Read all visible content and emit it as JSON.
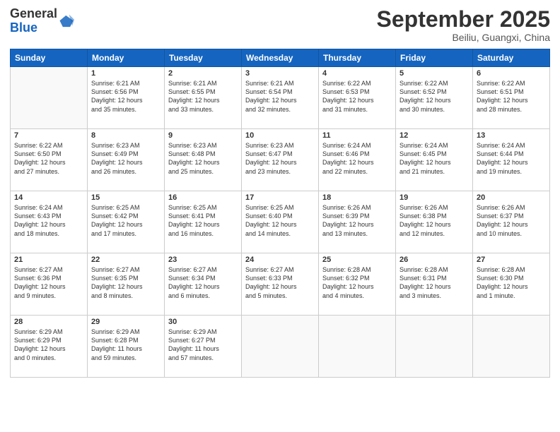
{
  "header": {
    "logo_general": "General",
    "logo_blue": "Blue",
    "month_title": "September 2025",
    "location": "Beiliu, Guangxi, China"
  },
  "days_of_week": [
    "Sunday",
    "Monday",
    "Tuesday",
    "Wednesday",
    "Thursday",
    "Friday",
    "Saturday"
  ],
  "weeks": [
    [
      {
        "num": "",
        "info": ""
      },
      {
        "num": "1",
        "info": "Sunrise: 6:21 AM\nSunset: 6:56 PM\nDaylight: 12 hours\nand 35 minutes."
      },
      {
        "num": "2",
        "info": "Sunrise: 6:21 AM\nSunset: 6:55 PM\nDaylight: 12 hours\nand 33 minutes."
      },
      {
        "num": "3",
        "info": "Sunrise: 6:21 AM\nSunset: 6:54 PM\nDaylight: 12 hours\nand 32 minutes."
      },
      {
        "num": "4",
        "info": "Sunrise: 6:22 AM\nSunset: 6:53 PM\nDaylight: 12 hours\nand 31 minutes."
      },
      {
        "num": "5",
        "info": "Sunrise: 6:22 AM\nSunset: 6:52 PM\nDaylight: 12 hours\nand 30 minutes."
      },
      {
        "num": "6",
        "info": "Sunrise: 6:22 AM\nSunset: 6:51 PM\nDaylight: 12 hours\nand 28 minutes."
      }
    ],
    [
      {
        "num": "7",
        "info": "Sunrise: 6:22 AM\nSunset: 6:50 PM\nDaylight: 12 hours\nand 27 minutes."
      },
      {
        "num": "8",
        "info": "Sunrise: 6:23 AM\nSunset: 6:49 PM\nDaylight: 12 hours\nand 26 minutes."
      },
      {
        "num": "9",
        "info": "Sunrise: 6:23 AM\nSunset: 6:48 PM\nDaylight: 12 hours\nand 25 minutes."
      },
      {
        "num": "10",
        "info": "Sunrise: 6:23 AM\nSunset: 6:47 PM\nDaylight: 12 hours\nand 23 minutes."
      },
      {
        "num": "11",
        "info": "Sunrise: 6:24 AM\nSunset: 6:46 PM\nDaylight: 12 hours\nand 22 minutes."
      },
      {
        "num": "12",
        "info": "Sunrise: 6:24 AM\nSunset: 6:45 PM\nDaylight: 12 hours\nand 21 minutes."
      },
      {
        "num": "13",
        "info": "Sunrise: 6:24 AM\nSunset: 6:44 PM\nDaylight: 12 hours\nand 19 minutes."
      }
    ],
    [
      {
        "num": "14",
        "info": "Sunrise: 6:24 AM\nSunset: 6:43 PM\nDaylight: 12 hours\nand 18 minutes."
      },
      {
        "num": "15",
        "info": "Sunrise: 6:25 AM\nSunset: 6:42 PM\nDaylight: 12 hours\nand 17 minutes."
      },
      {
        "num": "16",
        "info": "Sunrise: 6:25 AM\nSunset: 6:41 PM\nDaylight: 12 hours\nand 16 minutes."
      },
      {
        "num": "17",
        "info": "Sunrise: 6:25 AM\nSunset: 6:40 PM\nDaylight: 12 hours\nand 14 minutes."
      },
      {
        "num": "18",
        "info": "Sunrise: 6:26 AM\nSunset: 6:39 PM\nDaylight: 12 hours\nand 13 minutes."
      },
      {
        "num": "19",
        "info": "Sunrise: 6:26 AM\nSunset: 6:38 PM\nDaylight: 12 hours\nand 12 minutes."
      },
      {
        "num": "20",
        "info": "Sunrise: 6:26 AM\nSunset: 6:37 PM\nDaylight: 12 hours\nand 10 minutes."
      }
    ],
    [
      {
        "num": "21",
        "info": "Sunrise: 6:27 AM\nSunset: 6:36 PM\nDaylight: 12 hours\nand 9 minutes."
      },
      {
        "num": "22",
        "info": "Sunrise: 6:27 AM\nSunset: 6:35 PM\nDaylight: 12 hours\nand 8 minutes."
      },
      {
        "num": "23",
        "info": "Sunrise: 6:27 AM\nSunset: 6:34 PM\nDaylight: 12 hours\nand 6 minutes."
      },
      {
        "num": "24",
        "info": "Sunrise: 6:27 AM\nSunset: 6:33 PM\nDaylight: 12 hours\nand 5 minutes."
      },
      {
        "num": "25",
        "info": "Sunrise: 6:28 AM\nSunset: 6:32 PM\nDaylight: 12 hours\nand 4 minutes."
      },
      {
        "num": "26",
        "info": "Sunrise: 6:28 AM\nSunset: 6:31 PM\nDaylight: 12 hours\nand 3 minutes."
      },
      {
        "num": "27",
        "info": "Sunrise: 6:28 AM\nSunset: 6:30 PM\nDaylight: 12 hours\nand 1 minute."
      }
    ],
    [
      {
        "num": "28",
        "info": "Sunrise: 6:29 AM\nSunset: 6:29 PM\nDaylight: 12 hours\nand 0 minutes."
      },
      {
        "num": "29",
        "info": "Sunrise: 6:29 AM\nSunset: 6:28 PM\nDaylight: 11 hours\nand 59 minutes."
      },
      {
        "num": "30",
        "info": "Sunrise: 6:29 AM\nSunset: 6:27 PM\nDaylight: 11 hours\nand 57 minutes."
      },
      {
        "num": "",
        "info": ""
      },
      {
        "num": "",
        "info": ""
      },
      {
        "num": "",
        "info": ""
      },
      {
        "num": "",
        "info": ""
      }
    ]
  ]
}
